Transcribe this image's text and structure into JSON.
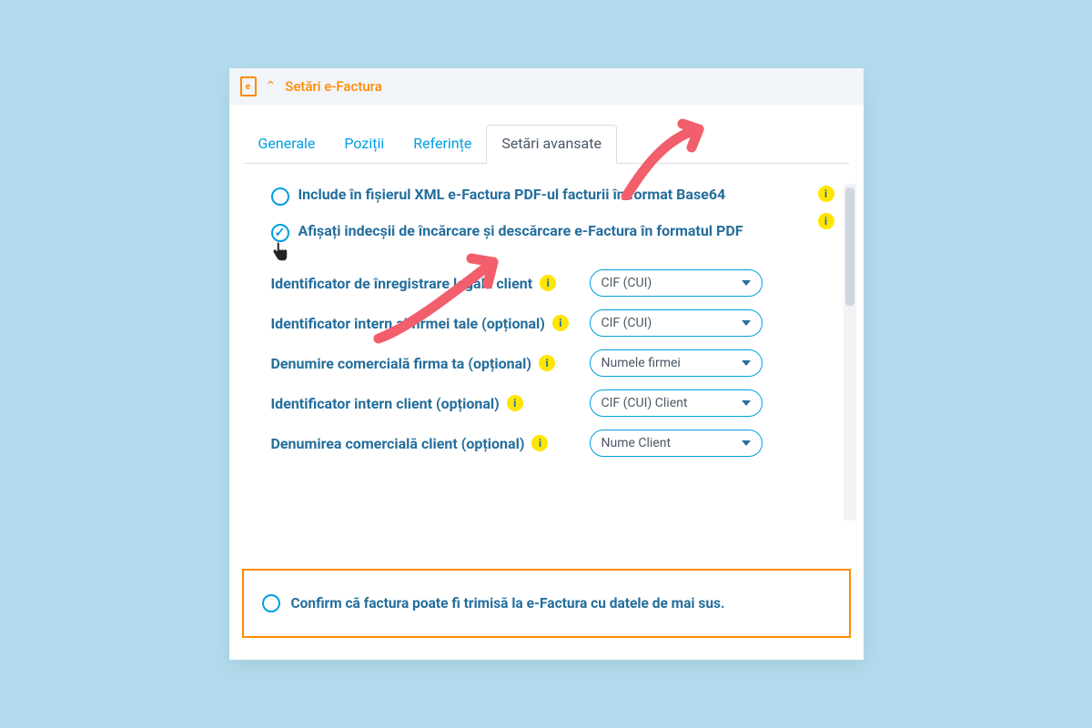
{
  "header": {
    "icon_letter": "e",
    "chevron": "⌃",
    "title": "Setări e-Factura"
  },
  "tabs": [
    {
      "label": "Generale",
      "active": false
    },
    {
      "label": "Poziții",
      "active": false
    },
    {
      "label": "Referințe",
      "active": false
    },
    {
      "label": "Setări avansate",
      "active": true
    }
  ],
  "options": [
    {
      "label": "Include în fișierul XML e-Factura PDF-ul facturii în format Base64",
      "checked": false
    },
    {
      "label": "Afișați indecșii de încărcare și descărcare e-Factura în formatul PDF",
      "checked": true,
      "has_cursor": true
    }
  ],
  "fields": [
    {
      "label": "Identificator de înregistrare legală client",
      "value": "CIF (CUI)"
    },
    {
      "label": "Identificator intern al firmei tale (opțional)",
      "value": "CIF (CUI)"
    },
    {
      "label": "Denumire comercială firma ta (opțional)",
      "value": "Numele firmei"
    },
    {
      "label": "Identificator intern client (opțional)",
      "value": "CIF (CUI) Client"
    },
    {
      "label": "Denumirea comercială client (opțional)",
      "value": "Nume Client"
    }
  ],
  "confirm": {
    "text": "Confirm că factura poate fi trimisă la e-Factura cu datele de mai sus."
  },
  "info_char": "i"
}
